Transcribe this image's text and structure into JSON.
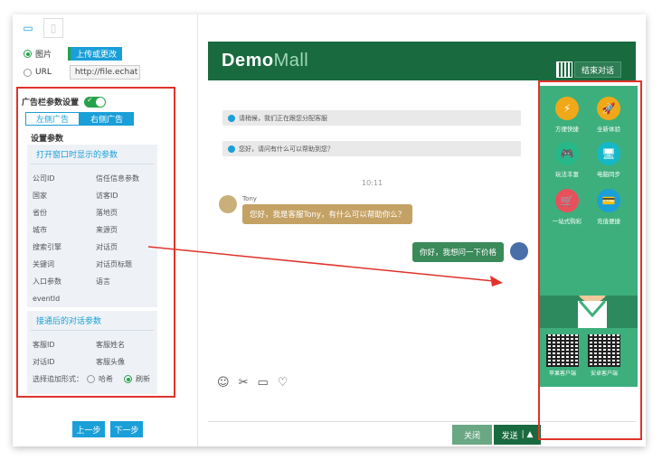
{
  "left": {
    "image_label": "图片",
    "upload_label": "上传或更改",
    "url_label": "URL",
    "url_value": "http://file.echat",
    "ad_settings_title": "广告栏参数设置",
    "toggle_on_label": "✓",
    "tabs": [
      "左侧广告",
      "右侧广告"
    ],
    "section_title": "设置参数",
    "open_box_title": "打开窗口时显示的参数",
    "open_params": [
      "公司ID",
      "信任信息参数",
      "国家",
      "访客ID",
      "省份",
      "落地页",
      "城市",
      "来源页",
      "搜索引擎",
      "对话页",
      "关键词",
      "对话页标题",
      "入口参数",
      "语言",
      "eventId",
      ""
    ],
    "connect_box_title": "接通后的对话参数",
    "connect_params": [
      "客服ID",
      "客服姓名",
      "对话ID",
      "客服头像"
    ],
    "add_mode_label": "选择追加形式：",
    "add_mode_options": [
      "哈希",
      "刷新"
    ],
    "prev_button": "上一步",
    "next_button": "下一步"
  },
  "chat": {
    "logo_demo": "Demo",
    "logo_mall": "Mall",
    "end_button": "结束对话",
    "sys_msg_1": "请稍候，我们正在跟您分配客服",
    "sys_msg_2": "您好，请问有什么可以帮助到您？",
    "time": "10:11",
    "agent_name": "Tony",
    "agent_msg": "您好，我是客服Tony，有什么可以帮助你么？",
    "user_msg": "你好，我想问一下价格",
    "close_button": "关闭",
    "send_button": "发送",
    "send_extra": "| ▲"
  },
  "ad": {
    "items": [
      {
        "label": "方便快捷",
        "color": "#f0a818",
        "icon": "⚡"
      },
      {
        "label": "全新体验",
        "color": "#f0a818",
        "icon": "🚀"
      },
      {
        "label": "玩法丰富",
        "color": "#27b88a",
        "icon": "🎮"
      },
      {
        "label": "电脑同步",
        "color": "#16b8c8",
        "icon": "🖥"
      },
      {
        "label": "一站式购彩",
        "color": "#e8505b",
        "icon": "🛒"
      },
      {
        "label": "充值便捷",
        "color": "#1a9fd8",
        "icon": "💳"
      }
    ],
    "qr_labels": [
      "苹果客户端",
      "安卓客户端"
    ]
  }
}
